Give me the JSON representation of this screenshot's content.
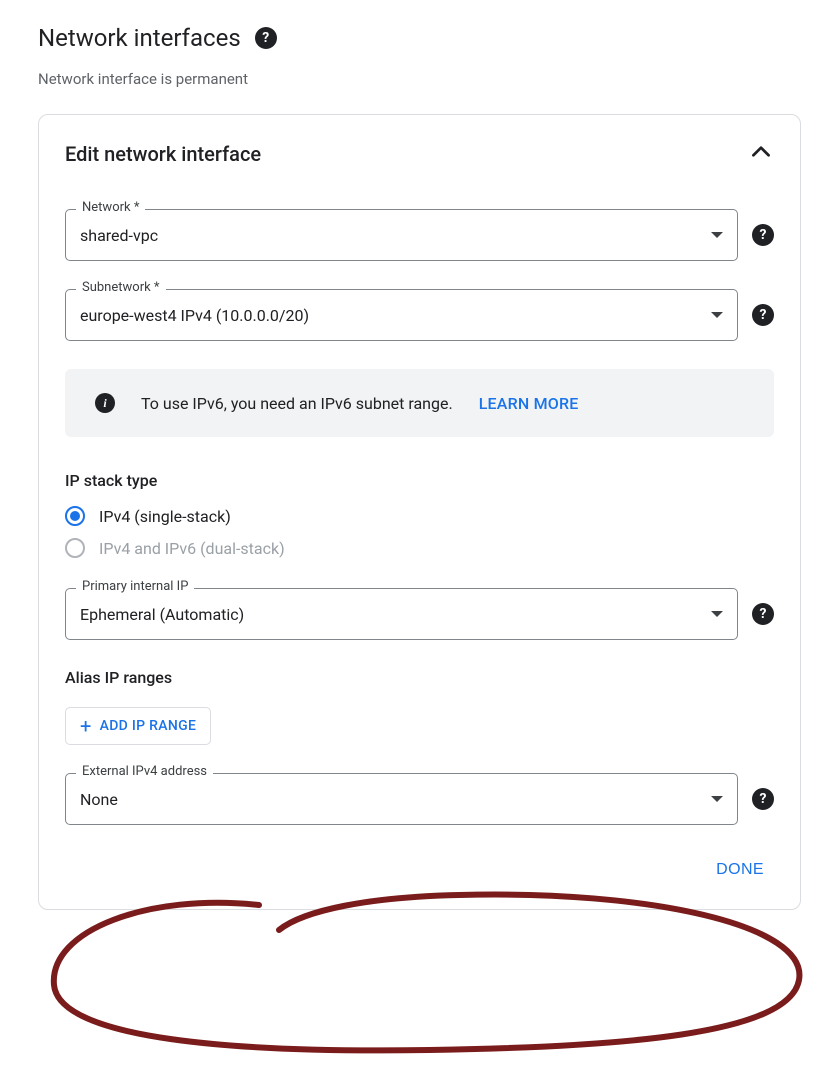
{
  "header": {
    "title": "Network interfaces",
    "subtext": "Network interface is permanent"
  },
  "card": {
    "title": "Edit network interface",
    "fields": {
      "network": {
        "label": "Network *",
        "value": "shared-vpc"
      },
      "subnetwork": {
        "label": "Subnetwork *",
        "value": "europe-west4 IPv4 (10.0.0.0/20)"
      },
      "primary_internal_ip": {
        "label": "Primary internal IP",
        "value": "Ephemeral (Automatic)"
      },
      "external_ipv4": {
        "label": "External IPv4 address",
        "value": "None"
      }
    },
    "info_banner": {
      "text": "To use IPv6, you need an IPv6 subnet range.",
      "link_text": "LEARN MORE"
    },
    "ip_stack": {
      "title": "IP stack type",
      "options": [
        {
          "label": "IPv4 (single-stack)",
          "selected": true,
          "enabled": true
        },
        {
          "label": "IPv4 and IPv6 (dual-stack)",
          "selected": false,
          "enabled": false
        }
      ]
    },
    "alias_title": "Alias IP ranges",
    "add_ip_range_label": "ADD IP RANGE",
    "done_label": "DONE"
  }
}
